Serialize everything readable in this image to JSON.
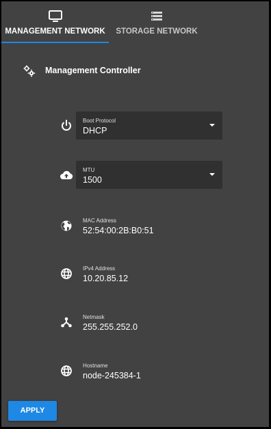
{
  "tabs": [
    {
      "label": "MANAGEMENT NETWORK",
      "icon": "monitor-icon",
      "active": true
    },
    {
      "label": "STORAGE NETWORK",
      "icon": "storage-icon",
      "active": false
    }
  ],
  "section": {
    "title": "Management Controller",
    "icon": "gear-icon"
  },
  "fields": {
    "boot_protocol": {
      "label": "Boot Protocol",
      "value": "DHCP",
      "icon": "power-icon"
    },
    "mtu": {
      "label": "MTU",
      "value": "1500",
      "icon": "cloud-upload-icon"
    },
    "mac": {
      "label": "MAC Address",
      "value": "52:54:00:2B:B0:51",
      "icon": "globe-icon"
    },
    "ipv4": {
      "label": "IPv4 Address",
      "value": "10.20.85.12",
      "icon": "globe-grid-icon"
    },
    "netmask": {
      "label": "Netmask",
      "value": "255.255.252.0",
      "icon": "network-icon"
    },
    "hostname": {
      "label": "Hostname",
      "value": "node-245384-1",
      "icon": "globe-grid-icon"
    }
  },
  "actions": {
    "apply_label": "APPLY"
  },
  "colors": {
    "accent": "#1e88e5",
    "panel": "#424242",
    "field_bg": "#303030"
  }
}
